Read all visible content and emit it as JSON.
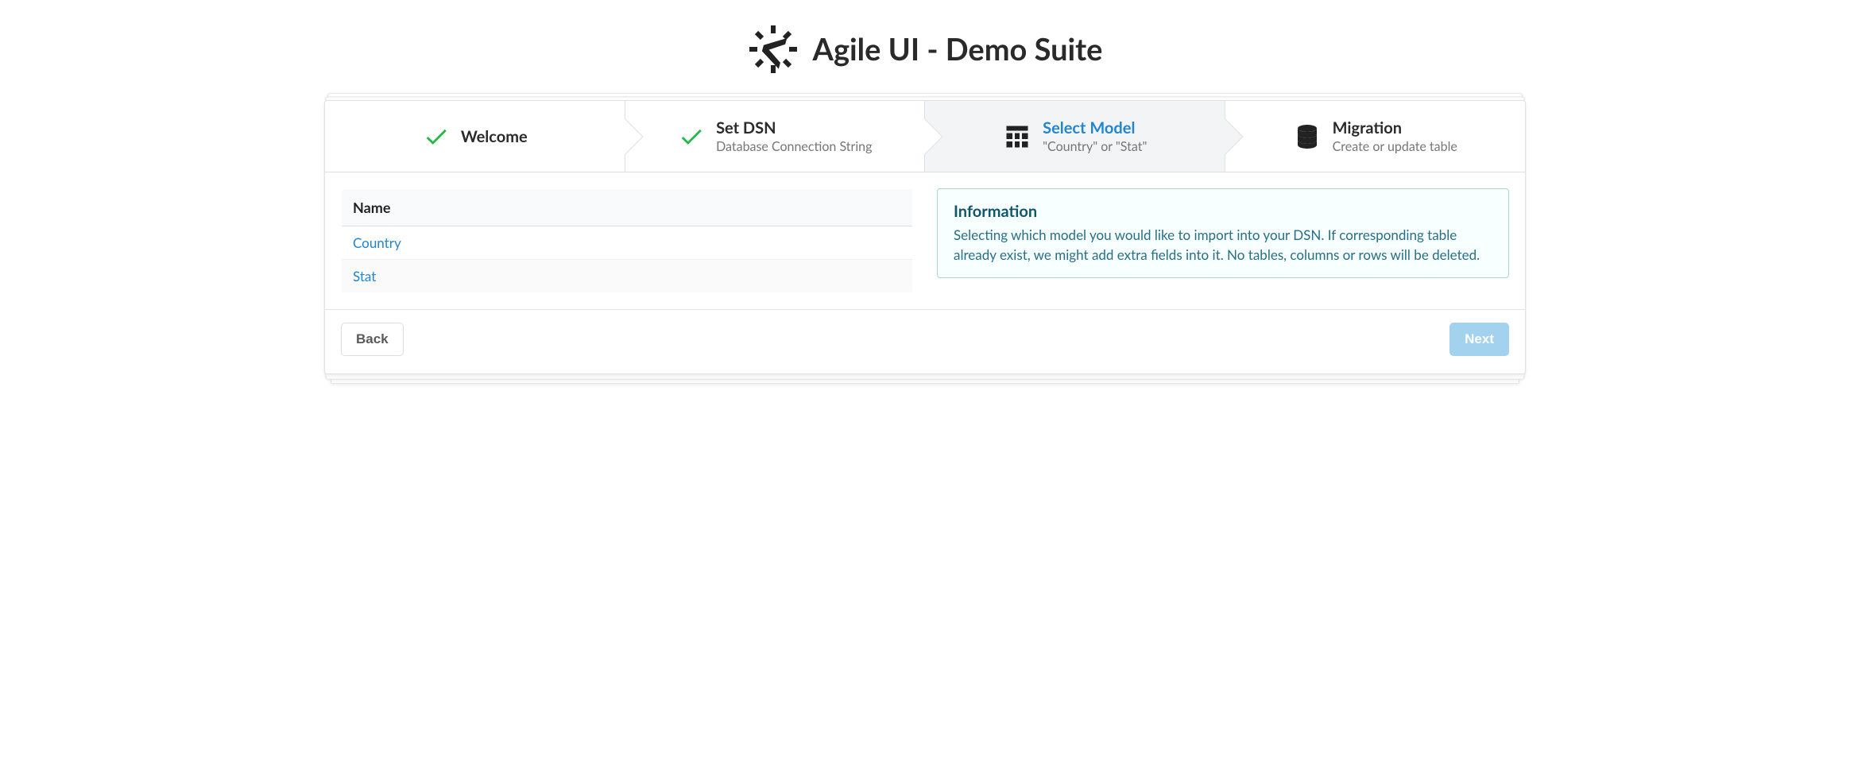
{
  "brand": {
    "title": "Agile UI - Demo Suite"
  },
  "steps": {
    "welcome": {
      "title": "Welcome"
    },
    "setdsn": {
      "title": "Set DSN",
      "desc": "Database Connection String"
    },
    "select": {
      "title": "Select Model",
      "desc": "\"Country\" or \"Stat\""
    },
    "migration": {
      "title": "Migration",
      "desc": "Create or update table"
    }
  },
  "table": {
    "header": "Name",
    "rows": [
      "Country",
      "Stat"
    ]
  },
  "info": {
    "header": "Information",
    "body": "Selecting which model you would like to import into your DSN. If corresponding table already exist, we might add extra fields into it. No tables, columns or rows will be deleted."
  },
  "actions": {
    "back": "Back",
    "next": "Next"
  }
}
